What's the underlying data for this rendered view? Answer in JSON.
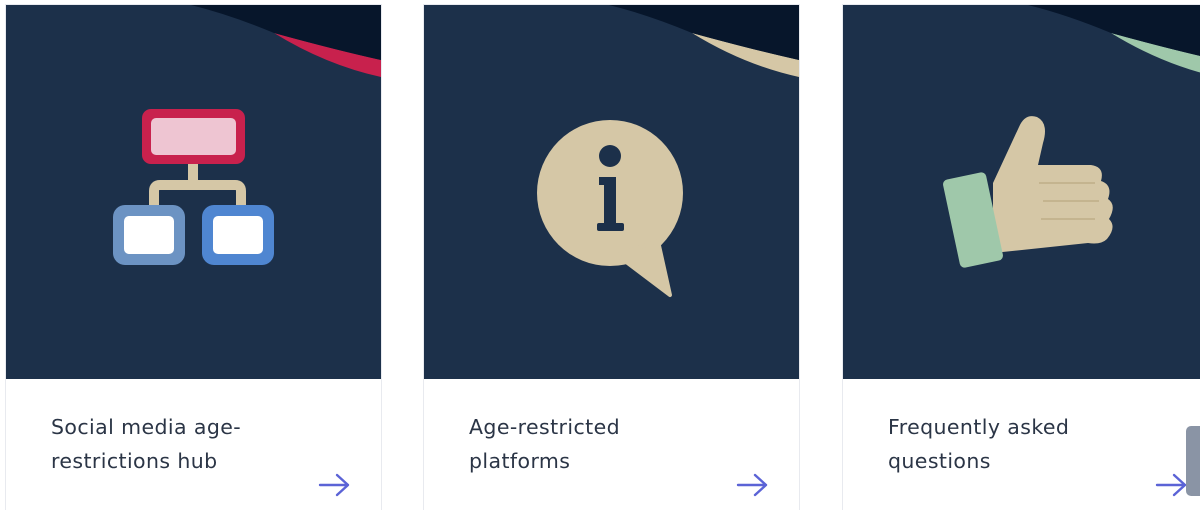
{
  "cards": [
    {
      "title": "Social media age-restrictions hub",
      "icon": "sitemap-icon",
      "accent_color": "#c8214d",
      "link_icon": "arrow-right-icon"
    },
    {
      "title": "Age-restricted platforms",
      "icon": "info-speech-bubble-icon",
      "accent_color": "#d5c7a6",
      "link_icon": "arrow-right-icon"
    },
    {
      "title": "Frequently asked questions",
      "icon": "thumbs-up-icon",
      "accent_color": "#9fc8aa",
      "link_icon": "arrow-right-icon"
    }
  ],
  "colors": {
    "card_background": "#1c304a",
    "corner_dark": "#07162b",
    "title_text": "#2b3546",
    "arrow": "#5b63d6"
  }
}
